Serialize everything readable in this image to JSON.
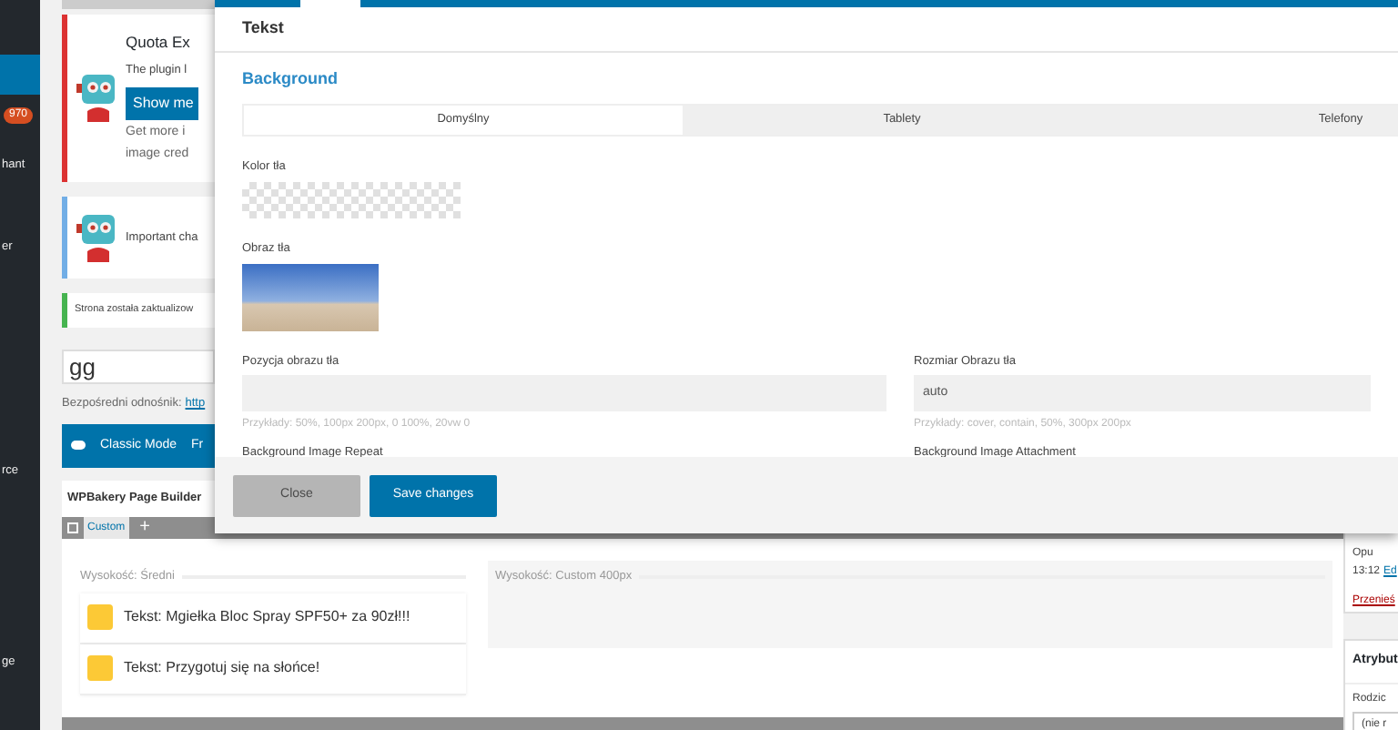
{
  "admin_menu": {
    "items": [
      {
        "selected": true
      },
      {
        "badge": "970",
        "selected": false
      },
      {
        "label": "hant",
        "selected": false
      },
      {
        "label": "er",
        "selected": false
      },
      {
        "label": "rce",
        "selected": false
      },
      {
        "label": "ge",
        "selected": false
      }
    ]
  },
  "notices": [
    {
      "kind": "plugin",
      "title": "Quota Ex",
      "text": "The plugin l",
      "button": "Show me",
      "extra": [
        "Get more i",
        "image cred"
      ],
      "color": "#dc3232"
    },
    {
      "kind": "plugin",
      "text": "Important cha",
      "color": "#72aee6"
    },
    {
      "kind": "plain",
      "text": "Strona została zaktualizow",
      "color": "#46b450"
    }
  ],
  "post_title": {
    "value": "gg"
  },
  "permalink": {
    "label": "Bezpośredni odnośnik:",
    "link": "http"
  },
  "editor_bar": {
    "buttons": [
      "Classic Mode",
      "Fr"
    ]
  },
  "page_builder": {
    "tab": "WPBakery Page Builder",
    "row_label": "Custom",
    "add": "+",
    "columns": [
      {
        "height": "Wysokość: Średni",
        "items": [
          "Tekst: Mgiełka Bloc Spray SPF50+ za 90zł!!!",
          "Tekst: Przygotuj się na słońce!"
        ]
      },
      {
        "height": "Wysokość: Custom 400px"
      }
    ]
  },
  "side_panel": {
    "status": "Opu",
    "time": "13:12",
    "time_link": "Ed",
    "trash": "Przenieś",
    "attributes_title": "Atrybut",
    "parent_label": "Rodzic",
    "parent_value": "(nie r"
  },
  "modal": {
    "title": "Tekst",
    "section": "Background",
    "tabs": [
      {
        "label": "Domyślny",
        "selected": true
      },
      {
        "label": "Tablety",
        "selected": false
      },
      {
        "label": "Telefony",
        "selected": false
      }
    ],
    "color_label": "Kolor tła",
    "image_label": "Obraz tła",
    "fields": [
      {
        "label": "Pozycja obrazu tła",
        "hint": "Przykłady: 50%, 100px 200px, 0 100%, 20vw 0"
      },
      {
        "label": "Rozmiar Obrazu tła",
        "value": "auto",
        "hint": "Przykłady: cover, contain, 50%, 300px 200px"
      }
    ],
    "next_labels": [
      "Background Image Repeat",
      "Background Image Attachment"
    ],
    "buttons": [
      {
        "label": "Close",
        "kind": "secondary"
      },
      {
        "label": "Save changes",
        "kind": "primary"
      }
    ]
  }
}
